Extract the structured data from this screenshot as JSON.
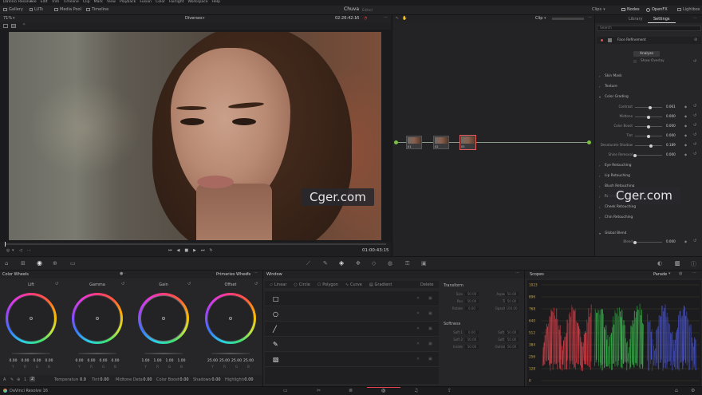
{
  "menu": {
    "app": "DaVinci Resolve",
    "items": [
      "File",
      "Edit",
      "Trim",
      "Timeline",
      "Clip",
      "Mark",
      "View",
      "Playback",
      "Fusion",
      "Color",
      "Fairlight",
      "Workspace",
      "Help"
    ],
    "project_title": "Chuva",
    "project_status": "Edited"
  },
  "toolbar": {
    "gallery": "Gallery",
    "luts": "LUTs",
    "media_pool": "Media Pool",
    "timeline": "Timeline",
    "clips": "Clips",
    "nodes": "Nodes",
    "openfx": "OpenFX",
    "lightbox": "Lightbox"
  },
  "viewer": {
    "zoom": "71%",
    "clip_name": "Diversos",
    "timecode_top": "02:26:42:15",
    "timecode_bottom": "01:00:43:15"
  },
  "nodes_panel": {
    "mode": "Clip",
    "node_labels": [
      "01",
      "02",
      "03"
    ]
  },
  "openfx": {
    "tabs": [
      "Library",
      "Settings"
    ],
    "search_placeholder": "Search",
    "effect_name": "Face Refinement",
    "analyze_label": "Analyze",
    "show_overlay": "Show Overlay",
    "sections": {
      "skin_mask": "Skin Mask",
      "texture": "Texture",
      "color_grading": "Color Grading",
      "eye_retouching": "Eye Retouching",
      "lip_retouching": "Lip Retouching",
      "blush_retouching": "Blush Retouching",
      "forehead_retouching": "Forehead Retouching",
      "cheek_retouching": "Cheek Retouching",
      "chin_retouching": "Chin Retouching",
      "global_blend": "Global Blend"
    },
    "params": [
      {
        "label": "Contrast",
        "value": "0.061",
        "fraction": 0.55
      },
      {
        "label": "Midtone",
        "value": "0.000",
        "fraction": 0.5
      },
      {
        "label": "Color Boost",
        "value": "0.000",
        "fraction": 0.5
      },
      {
        "label": "Tint",
        "value": "0.000",
        "fraction": 0.5
      },
      {
        "label": "Desaturate Shadow",
        "value": "0.189",
        "fraction": 0.6
      },
      {
        "label": "Shine Removal",
        "value": "0.000",
        "fraction": 0.0
      }
    ],
    "blend": {
      "label": "Blend",
      "value": "0.000",
      "fraction": 0.0
    }
  },
  "color_wheels": {
    "title": "Color Wheels",
    "mode": "Primaries Wheels",
    "wheels": [
      {
        "name": "Lift",
        "values": [
          "0.00",
          "0.00",
          "0.00",
          "0.00"
        ],
        "rim": "#3a3a3c"
      },
      {
        "name": "Gamma",
        "values": [
          "0.00",
          "0.00",
          "0.00",
          "0.00"
        ],
        "rim": "#3a3a3c"
      },
      {
        "name": "Gain",
        "values": [
          "1.00",
          "1.00",
          "1.00",
          "1.00"
        ],
        "rim": "#6a6a6e"
      },
      {
        "name": "Offset",
        "values": [
          "25.00",
          "25.00",
          "25.00",
          "25.00"
        ],
        "rim": "#3a3a3c"
      }
    ],
    "channel_letters_lift": [
      "Y",
      "R",
      "G",
      "B"
    ],
    "channel_letters_other": [
      "Y",
      "R",
      "G",
      "B"
    ],
    "bottom": {
      "page_1": "1",
      "page_2": "2",
      "temperature_label": "Temperature",
      "temperature_value": "0.0",
      "tint_label": "Tint",
      "tint_value": "0.00",
      "midtone_label": "Midtone Detail",
      "midtone_value": "0.00",
      "boost_label": "Color Boost",
      "boost_value": "0.00",
      "shadows_label": "Shadows",
      "shadows_value": "0.00",
      "highlights_label": "Highlights",
      "highlights_value": "0.00"
    }
  },
  "window_panel": {
    "title": "Window",
    "tools": [
      "Linear",
      "Circle",
      "Polygon",
      "Curve",
      "Gradient"
    ],
    "delete_label": "Delete",
    "transform_title": "Transform",
    "transform_rows": [
      [
        "Size",
        "50.00",
        "Aspect",
        "50.00"
      ],
      [
        "Pan",
        "50.00",
        "Tilt",
        "50.00"
      ],
      [
        "Rotate",
        "0.00",
        "Opacity",
        "100.00"
      ]
    ],
    "softness_title": "Softness",
    "softness_rows": [
      [
        "Soft 1",
        "0.00",
        "Soft 3",
        "50.00"
      ],
      [
        "Soft 2",
        "50.00",
        "Soft 4",
        "50.00"
      ],
      [
        "Inside",
        "50.00",
        "Outside",
        "50.00"
      ]
    ]
  },
  "scopes": {
    "title": "Scopes",
    "mode": "Parade",
    "ticks": [
      "1023",
      "896",
      "768",
      "640",
      "512",
      "384",
      "256",
      "128",
      "0"
    ],
    "colors": {
      "red": "#ff4a55",
      "green": "#3dde55",
      "blue": "#5260ff"
    }
  },
  "statusbar": {
    "app_version": "DaVinci Resolve 16"
  },
  "watermark": {
    "left": "Cger.com",
    "right": "Cger.com"
  }
}
